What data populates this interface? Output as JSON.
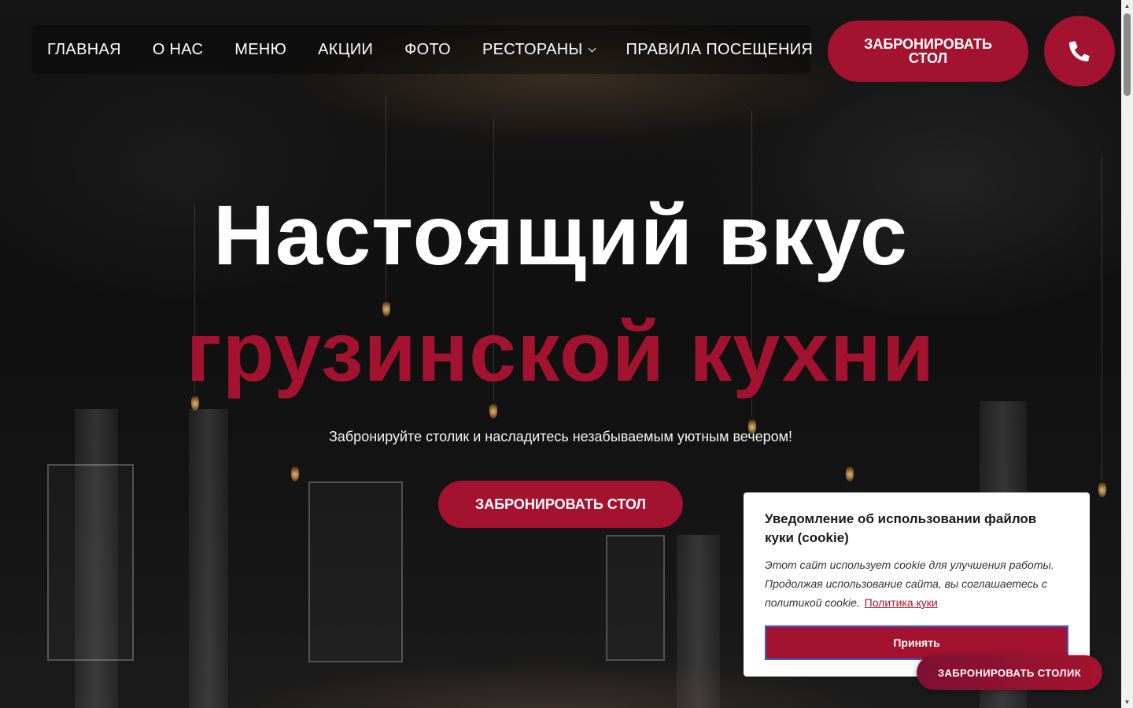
{
  "nav": {
    "items": [
      {
        "label": "ГЛАВНАЯ",
        "name": "nav-item-home"
      },
      {
        "label": "О НАС",
        "name": "nav-item-about"
      },
      {
        "label": "МЕНЮ",
        "name": "nav-item-menu"
      },
      {
        "label": "АКЦИИ",
        "name": "nav-item-promotions"
      },
      {
        "label": "ФОТО",
        "name": "nav-item-photo"
      },
      {
        "label": "РЕСТОРАНЫ",
        "name": "nav-item-restaurants",
        "has_dropdown": true
      },
      {
        "label": "ПРАВИЛА ПОСЕЩЕНИЯ",
        "name": "nav-item-rules"
      }
    ],
    "book_button": "ЗАБРОНИРОВАТЬ\nСТОЛ",
    "phone_icon": "phone-icon"
  },
  "hero": {
    "title_line1": "Настоящий вкус",
    "title_line2": "грузинской кухни",
    "subtitle": "Забронируйте столик и насладитесь незабываемым уютным вечером!",
    "cta": "ЗАБРОНИРОВАТЬ СТОЛ"
  },
  "cookie": {
    "title": "Уведомление об использовании файлов куки (cookie)",
    "text": "Этот сайт использует cookie для улучшения работы. Продолжая использование сайта, вы соглашаетесь с политикой cookie.",
    "link": "Политика куки",
    "accept": "Принять"
  },
  "floating_button": "ЗАБРОНИРОВАТЬ СТОЛИК",
  "colors": {
    "accent": "#a3132f",
    "background": "#111111",
    "text": "#ffffff"
  }
}
